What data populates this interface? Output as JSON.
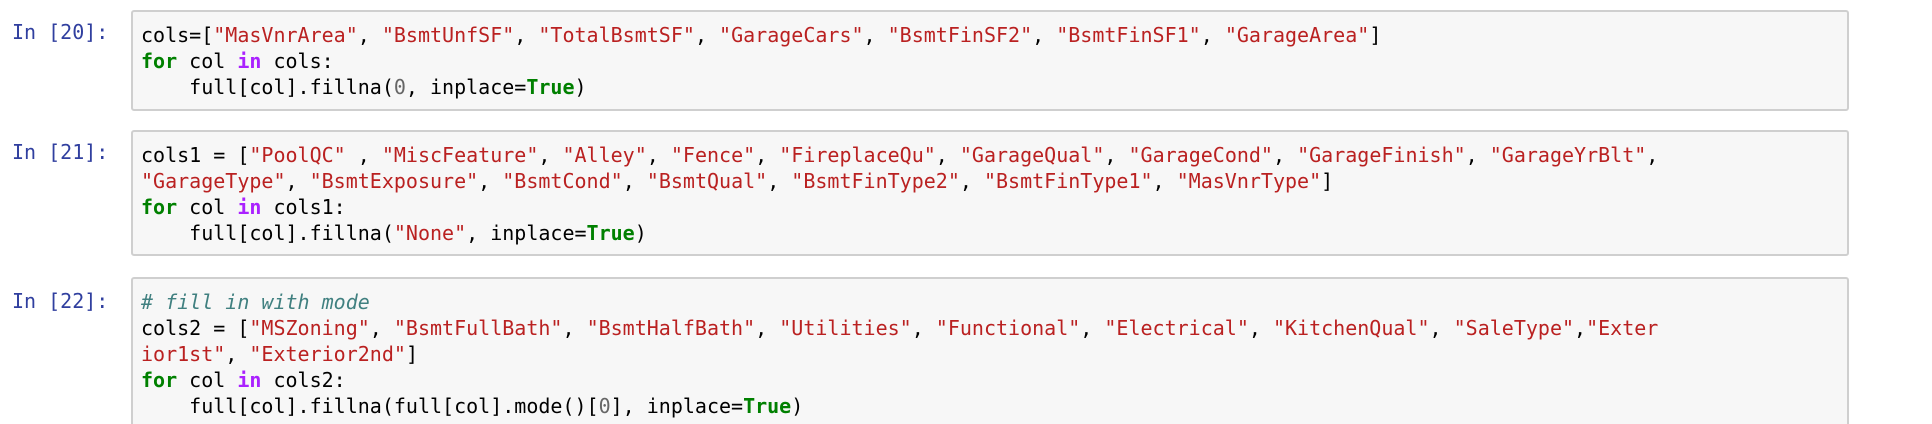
{
  "cells": [
    {
      "prompt": "In [20]:",
      "lines": [
        [
          {
            "t": "p",
            "v": "cols=["
          },
          {
            "t": "s",
            "v": "\"MasVnrArea\""
          },
          {
            "t": "p",
            "v": ", "
          },
          {
            "t": "s",
            "v": "\"BsmtUnfSF\""
          },
          {
            "t": "p",
            "v": ", "
          },
          {
            "t": "s",
            "v": "\"TotalBsmtSF\""
          },
          {
            "t": "p",
            "v": ", "
          },
          {
            "t": "s",
            "v": "\"GarageCars\""
          },
          {
            "t": "p",
            "v": ", "
          },
          {
            "t": "s",
            "v": "\"BsmtFinSF2\""
          },
          {
            "t": "p",
            "v": ", "
          },
          {
            "t": "s",
            "v": "\"BsmtFinSF1\""
          },
          {
            "t": "p",
            "v": ", "
          },
          {
            "t": "s",
            "v": "\"GarageArea\""
          },
          {
            "t": "p",
            "v": "]"
          }
        ],
        [
          {
            "t": "k",
            "v": "for"
          },
          {
            "t": "p",
            "v": " col "
          },
          {
            "t": "o",
            "v": "in"
          },
          {
            "t": "p",
            "v": " cols:"
          }
        ],
        [
          {
            "t": "p",
            "v": "    full[col].fillna("
          },
          {
            "t": "n",
            "v": "0"
          },
          {
            "t": "p",
            "v": ", inplace="
          },
          {
            "t": "k",
            "v": "True"
          },
          {
            "t": "p",
            "v": ")"
          }
        ]
      ]
    },
    {
      "prompt": "In [21]:",
      "lines": [
        [
          {
            "t": "p",
            "v": "cols1 = ["
          },
          {
            "t": "s",
            "v": "\"PoolQC\""
          },
          {
            "t": "p",
            "v": " , "
          },
          {
            "t": "s",
            "v": "\"MiscFeature\""
          },
          {
            "t": "p",
            "v": ", "
          },
          {
            "t": "s",
            "v": "\"Alley\""
          },
          {
            "t": "p",
            "v": ", "
          },
          {
            "t": "s",
            "v": "\"Fence\""
          },
          {
            "t": "p",
            "v": ", "
          },
          {
            "t": "s",
            "v": "\"FireplaceQu\""
          },
          {
            "t": "p",
            "v": ", "
          },
          {
            "t": "s",
            "v": "\"GarageQual\""
          },
          {
            "t": "p",
            "v": ", "
          },
          {
            "t": "s",
            "v": "\"GarageCond\""
          },
          {
            "t": "p",
            "v": ", "
          },
          {
            "t": "s",
            "v": "\"GarageFinish\""
          },
          {
            "t": "p",
            "v": ", "
          },
          {
            "t": "s",
            "v": "\"GarageYrBlt\""
          },
          {
            "t": "p",
            "v": ","
          }
        ],
        [
          {
            "t": "s",
            "v": "\"GarageType\""
          },
          {
            "t": "p",
            "v": ", "
          },
          {
            "t": "s",
            "v": "\"BsmtExposure\""
          },
          {
            "t": "p",
            "v": ", "
          },
          {
            "t": "s",
            "v": "\"BsmtCond\""
          },
          {
            "t": "p",
            "v": ", "
          },
          {
            "t": "s",
            "v": "\"BsmtQual\""
          },
          {
            "t": "p",
            "v": ", "
          },
          {
            "t": "s",
            "v": "\"BsmtFinType2\""
          },
          {
            "t": "p",
            "v": ", "
          },
          {
            "t": "s",
            "v": "\"BsmtFinType1\""
          },
          {
            "t": "p",
            "v": ", "
          },
          {
            "t": "s",
            "v": "\"MasVnrType\""
          },
          {
            "t": "p",
            "v": "]"
          }
        ],
        [
          {
            "t": "k",
            "v": "for"
          },
          {
            "t": "p",
            "v": " col "
          },
          {
            "t": "o",
            "v": "in"
          },
          {
            "t": "p",
            "v": " cols1:"
          }
        ],
        [
          {
            "t": "p",
            "v": "    full[col].fillna("
          },
          {
            "t": "s",
            "v": "\"None\""
          },
          {
            "t": "p",
            "v": ", inplace="
          },
          {
            "t": "k",
            "v": "True"
          },
          {
            "t": "p",
            "v": ")"
          }
        ]
      ]
    },
    {
      "prompt": "In [22]:",
      "lines": [
        [
          {
            "t": "c",
            "v": "# fill in with mode"
          }
        ],
        [
          {
            "t": "p",
            "v": "cols2 = ["
          },
          {
            "t": "s",
            "v": "\"MSZoning\""
          },
          {
            "t": "p",
            "v": ", "
          },
          {
            "t": "s",
            "v": "\"BsmtFullBath\""
          },
          {
            "t": "p",
            "v": ", "
          },
          {
            "t": "s",
            "v": "\"BsmtHalfBath\""
          },
          {
            "t": "p",
            "v": ", "
          },
          {
            "t": "s",
            "v": "\"Utilities\""
          },
          {
            "t": "p",
            "v": ", "
          },
          {
            "t": "s",
            "v": "\"Functional\""
          },
          {
            "t": "p",
            "v": ", "
          },
          {
            "t": "s",
            "v": "\"Electrical\""
          },
          {
            "t": "p",
            "v": ", "
          },
          {
            "t": "s",
            "v": "\"KitchenQual\""
          },
          {
            "t": "p",
            "v": ", "
          },
          {
            "t": "s",
            "v": "\"SaleType\""
          },
          {
            "t": "p",
            "v": ","
          },
          {
            "t": "s",
            "v": "\"Exter"
          }
        ],
        [
          {
            "t": "s",
            "v": "ior1st\""
          },
          {
            "t": "p",
            "v": ", "
          },
          {
            "t": "s",
            "v": "\"Exterior2nd\""
          },
          {
            "t": "p",
            "v": "]"
          }
        ],
        [
          {
            "t": "k",
            "v": "for"
          },
          {
            "t": "p",
            "v": " col "
          },
          {
            "t": "o",
            "v": "in"
          },
          {
            "t": "p",
            "v": " cols2:"
          }
        ],
        [
          {
            "t": "p",
            "v": "    full[col].fillna(full[col].mode()["
          },
          {
            "t": "n",
            "v": "0"
          },
          {
            "t": "p",
            "v": "], inplace="
          },
          {
            "t": "k",
            "v": "True"
          },
          {
            "t": "p",
            "v": ")"
          }
        ]
      ]
    }
  ],
  "colors": {
    "prompt": "#303f9f",
    "keyword": "#008000",
    "operator_word": "#aa22ff",
    "string": "#ba2121",
    "number": "#666666",
    "comment": "#408080",
    "cell_background": "#f7f7f7",
    "cell_border": "#cfcfcf"
  }
}
